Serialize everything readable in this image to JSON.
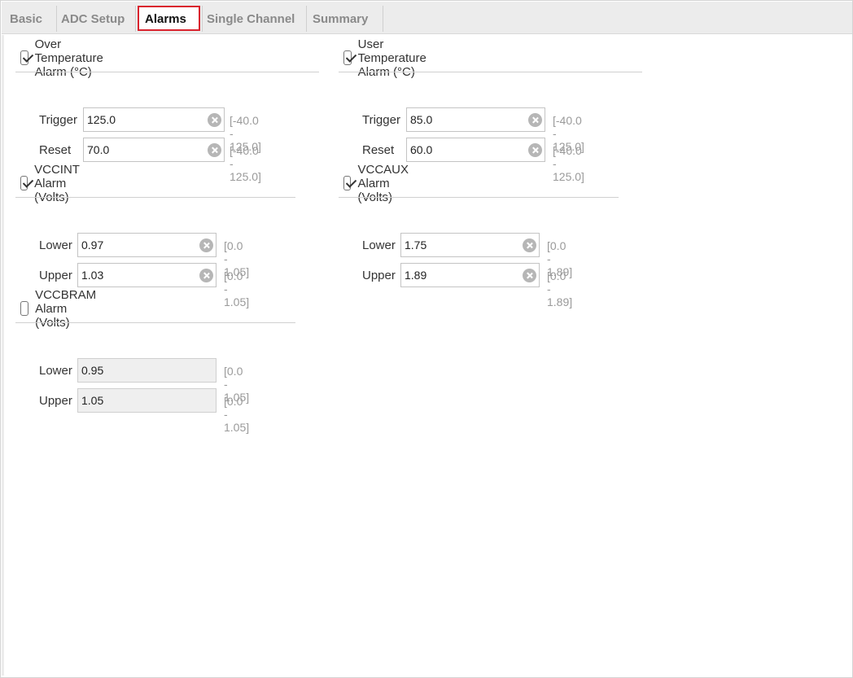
{
  "tabs": [
    {
      "label": "Basic",
      "active": false
    },
    {
      "label": "ADC Setup",
      "active": false
    },
    {
      "label": "Alarms",
      "active": true
    },
    {
      "label": "Single Channel",
      "active": false
    },
    {
      "label": "Summary",
      "active": false
    }
  ],
  "groups": {
    "over_temp": {
      "title": "Over Temperature Alarm (°C)",
      "checked": true,
      "fields": [
        {
          "label": "Trigger",
          "value": "125.0",
          "range": "[-40.0 - 125.0]"
        },
        {
          "label": "Reset",
          "value": "70.0",
          "range": "[-40.0 - 125.0]"
        }
      ]
    },
    "user_temp": {
      "title": "User Temperature Alarm (°C)",
      "checked": true,
      "fields": [
        {
          "label": "Trigger",
          "value": "85.0",
          "range": "[-40.0 - 125.0]"
        },
        {
          "label": "Reset",
          "value": "60.0",
          "range": "[-40.0 - 125.0]"
        }
      ]
    },
    "vccint": {
      "title": "VCCINT Alarm (Volts)",
      "checked": true,
      "fields": [
        {
          "label": "Lower",
          "value": "0.97",
          "range": "[0.0 - 1.05]"
        },
        {
          "label": "Upper",
          "value": "1.03",
          "range": "[0.0 - 1.05]"
        }
      ]
    },
    "vccaux": {
      "title": "VCCAUX Alarm (Volts)",
      "checked": true,
      "fields": [
        {
          "label": "Lower",
          "value": "1.75",
          "range": "[0.0 - 1.89]"
        },
        {
          "label": "Upper",
          "value": "1.89",
          "range": "[0.0 - 1.89]"
        }
      ]
    },
    "vccbram": {
      "title": "VCCBRAM Alarm (Volts)",
      "checked": false,
      "fields": [
        {
          "label": "Lower",
          "value": "0.95",
          "range": "[0.0 - 1.05]"
        },
        {
          "label": "Upper",
          "value": "1.05",
          "range": "[0.0 - 1.05]"
        }
      ]
    }
  }
}
